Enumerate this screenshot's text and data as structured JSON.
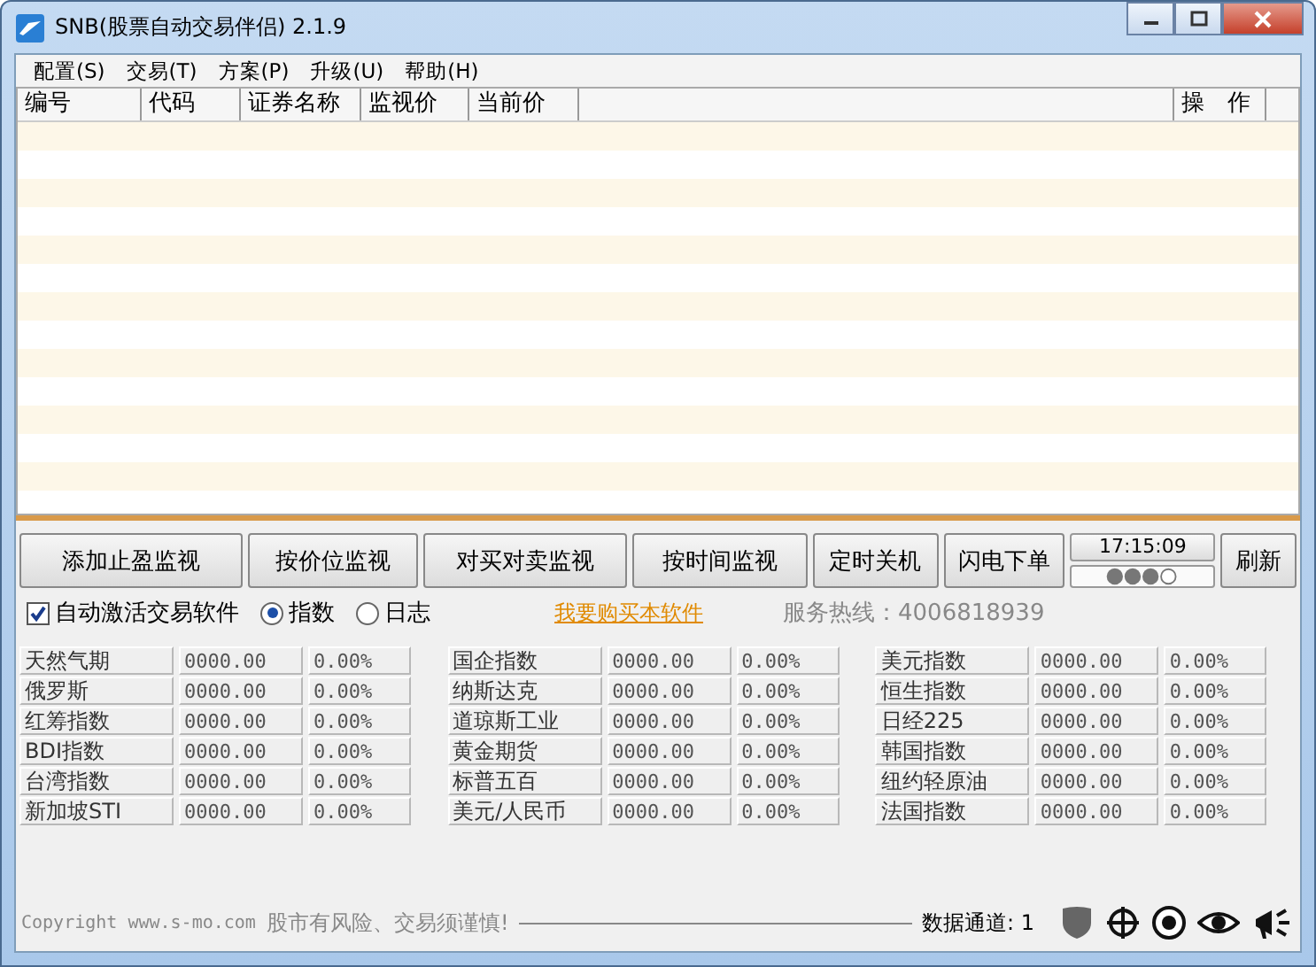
{
  "window": {
    "title": "SNB(股票自动交易伴侣) 2.1.9"
  },
  "menu": [
    "配置(S)",
    "交易(T)",
    "方案(P)",
    "升级(U)",
    "帮助(H)"
  ],
  "table": {
    "columns": [
      "编号",
      "代码",
      "证券名称",
      "监视价",
      "当前价",
      "",
      "操　作"
    ]
  },
  "buttons": [
    "添加止盈监视",
    "按价位监视",
    "对买对卖监视",
    "按时间监视",
    "定时关机",
    "闪电下单"
  ],
  "clock": "17:15:09",
  "refresh_button": "刷新",
  "auto_activate": {
    "label": "自动激活交易软件",
    "checked": true
  },
  "view_options": [
    {
      "label": "指数",
      "selected": true
    },
    {
      "label": "日志",
      "selected": false
    }
  ],
  "buy_link": "我要购买本软件",
  "hotline": "服务热线：4006818939",
  "index_rows": [
    [
      {
        "name": "天然气期",
        "value": "0000.00",
        "change": "0.00%"
      },
      {
        "name": "国企指数",
        "value": "0000.00",
        "change": "0.00%"
      },
      {
        "name": "美元指数",
        "value": "0000.00",
        "change": "0.00%"
      }
    ],
    [
      {
        "name": "俄罗斯",
        "value": "0000.00",
        "change": "0.00%"
      },
      {
        "name": "纳斯达克",
        "value": "0000.00",
        "change": "0.00%"
      },
      {
        "name": "恒生指数",
        "value": "0000.00",
        "change": "0.00%"
      }
    ],
    [
      {
        "name": "红筹指数",
        "value": "0000.00",
        "change": "0.00%"
      },
      {
        "name": "道琼斯工业",
        "value": "0000.00",
        "change": "0.00%"
      },
      {
        "name": "日经225",
        "value": "0000.00",
        "change": "0.00%"
      }
    ],
    [
      {
        "name": "BDI指数",
        "value": "0000.00",
        "change": "0.00%"
      },
      {
        "name": "黄金期货",
        "value": "0000.00",
        "change": "0.00%"
      },
      {
        "name": "韩国指数",
        "value": "0000.00",
        "change": "0.00%"
      }
    ],
    [
      {
        "name": "台湾指数",
        "value": "0000.00",
        "change": "0.00%"
      },
      {
        "name": "标普五百",
        "value": "0000.00",
        "change": "0.00%"
      },
      {
        "name": "纽约轻原油",
        "value": "0000.00",
        "change": "0.00%"
      }
    ],
    [
      {
        "name": "新加坡STI",
        "value": "0000.00",
        "change": "0.00%"
      },
      {
        "name": "美元/人民币",
        "value": "0000.00",
        "change": "0.00%"
      },
      {
        "name": "法国指数",
        "value": "0000.00",
        "change": "0.00%"
      }
    ]
  ],
  "footer": {
    "copyright": "Copyright www.s-mo.com",
    "warning": "股市有风险、交易须谨慎!",
    "channel": "数据通道: 1"
  }
}
